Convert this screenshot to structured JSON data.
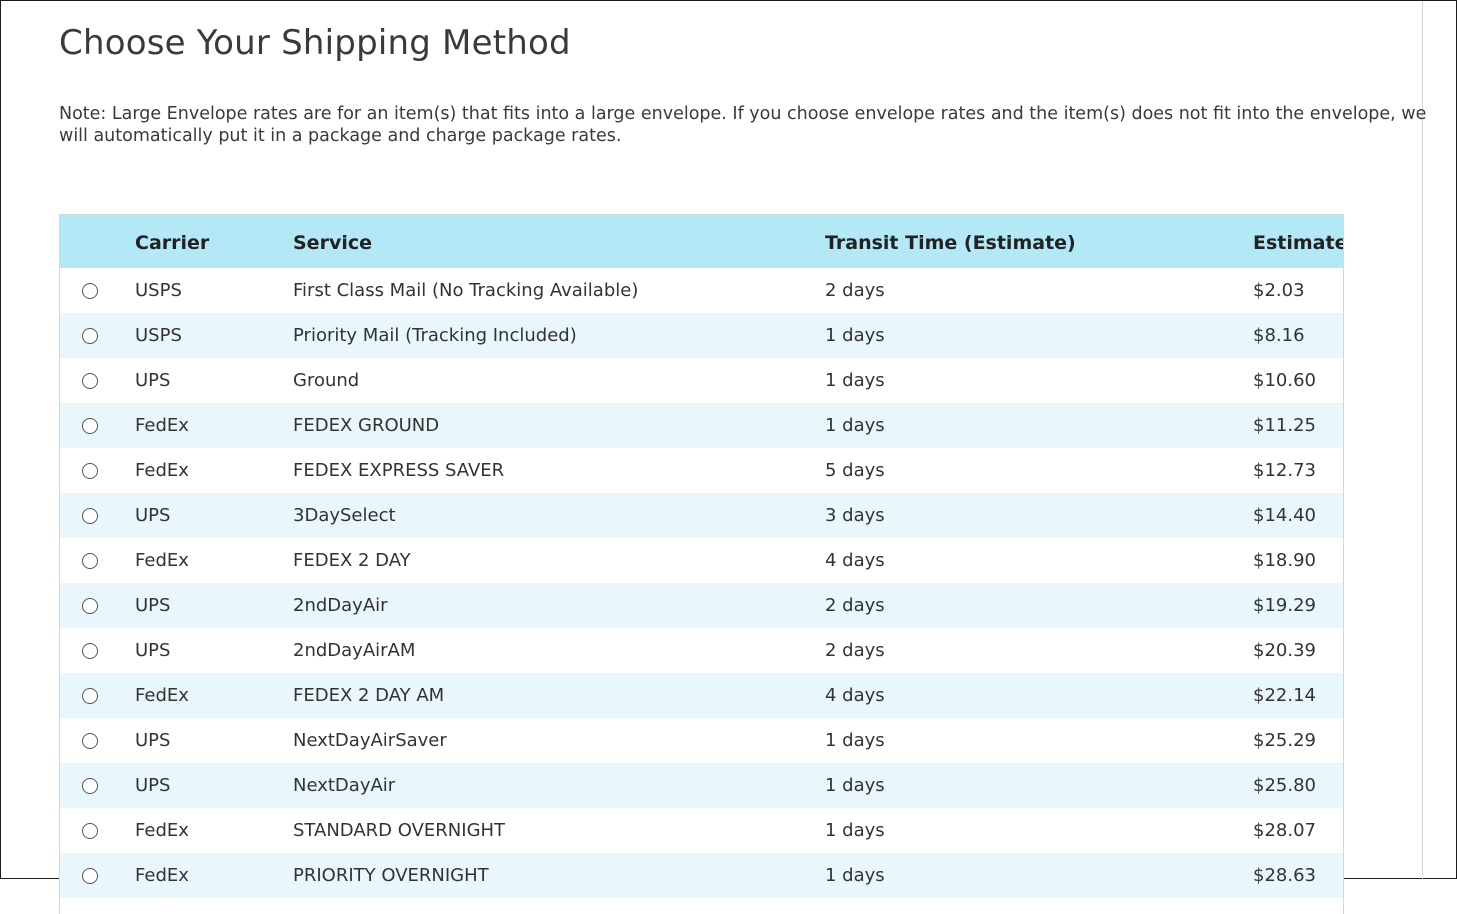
{
  "page": {
    "title": "Choose Your Shipping Method",
    "note": "Note: Large Envelope rates are for an item(s) that fits into a large envelope. If you choose envelope rates and the item(s) does not fit into the envelope, we will automatically put it in a package and charge package rates."
  },
  "table": {
    "headers": {
      "carrier": "Carrier",
      "service": "Service",
      "transit": "Transit Time (Estimate)",
      "estimate": "Estimate"
    },
    "rows": [
      {
        "carrier": "USPS",
        "service": "First Class Mail (No Tracking Available)",
        "transit": "2 days",
        "estimate": "$2.03"
      },
      {
        "carrier": "USPS",
        "service": "Priority Mail (Tracking Included)",
        "transit": "1 days",
        "estimate": "$8.16"
      },
      {
        "carrier": "UPS",
        "service": "Ground",
        "transit": "1 days",
        "estimate": "$10.60"
      },
      {
        "carrier": "FedEx",
        "service": "FEDEX GROUND",
        "transit": "1 days",
        "estimate": "$11.25"
      },
      {
        "carrier": "FedEx",
        "service": "FEDEX EXPRESS SAVER",
        "transit": "5 days",
        "estimate": "$12.73"
      },
      {
        "carrier": "UPS",
        "service": "3DaySelect",
        "transit": "3 days",
        "estimate": "$14.40"
      },
      {
        "carrier": "FedEx",
        "service": "FEDEX 2 DAY",
        "transit": "4 days",
        "estimate": "$18.90"
      },
      {
        "carrier": "UPS",
        "service": "2ndDayAir",
        "transit": "2 days",
        "estimate": "$19.29"
      },
      {
        "carrier": "UPS",
        "service": "2ndDayAirAM",
        "transit": "2 days",
        "estimate": "$20.39"
      },
      {
        "carrier": "FedEx",
        "service": "FEDEX 2 DAY AM",
        "transit": "4 days",
        "estimate": "$22.14"
      },
      {
        "carrier": "UPS",
        "service": "NextDayAirSaver",
        "transit": "1 days",
        "estimate": "$25.29"
      },
      {
        "carrier": "UPS",
        "service": "NextDayAir",
        "transit": "1 days",
        "estimate": "$25.80"
      },
      {
        "carrier": "FedEx",
        "service": "STANDARD OVERNIGHT",
        "transit": "1 days",
        "estimate": "$28.07"
      },
      {
        "carrier": "FedEx",
        "service": "PRIORITY OVERNIGHT",
        "transit": "1 days",
        "estimate": "$28.63"
      }
    ]
  }
}
